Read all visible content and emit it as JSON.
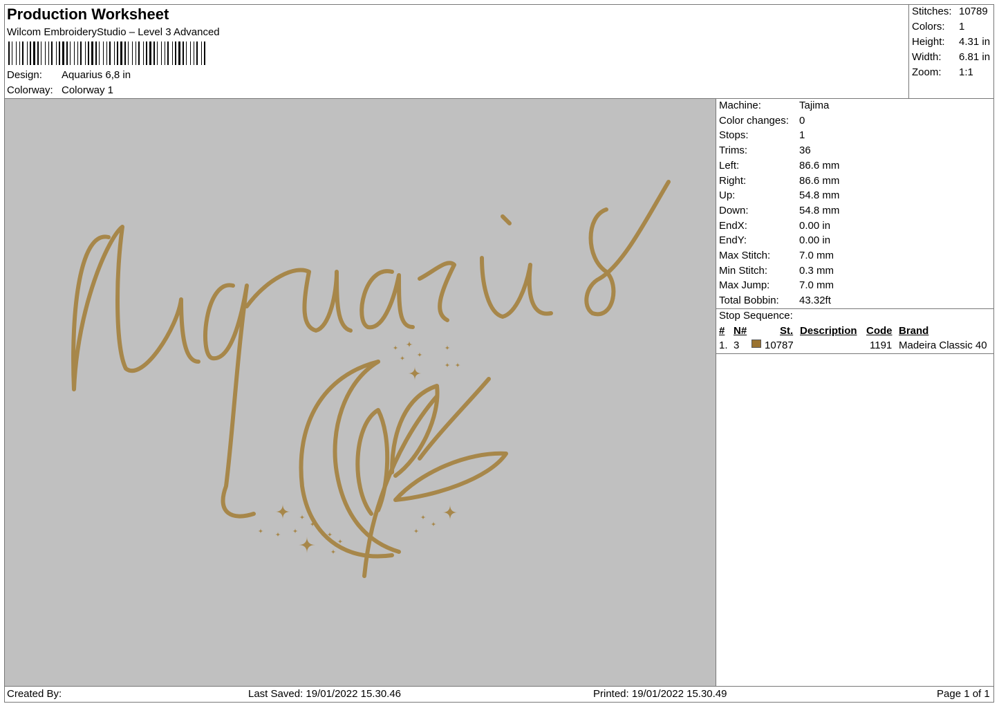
{
  "header": {
    "title": "Production Worksheet",
    "software": "Wilcom EmbroideryStudio – Level 3 Advanced",
    "design_label": "Design:",
    "design_value": "Aquarius 6,8 in",
    "colorway_label": "Colorway:",
    "colorway_value": "Colorway 1"
  },
  "summary": [
    {
      "label": "Stitches:",
      "value": "10789"
    },
    {
      "label": "Colors:",
      "value": "1"
    },
    {
      "label": "Height:",
      "value": "4.31 in"
    },
    {
      "label": "Width:",
      "value": "6.81 in"
    },
    {
      "label": "Zoom:",
      "value": "1:1"
    }
  ],
  "details": [
    {
      "label": "Machine:",
      "value": "Tajima"
    },
    {
      "label": "Color changes:",
      "value": "0"
    },
    {
      "label": "Stops:",
      "value": "1"
    },
    {
      "label": "Trims:",
      "value": "36"
    },
    {
      "label": "Left:",
      "value": "86.6 mm"
    },
    {
      "label": "Right:",
      "value": "86.6 mm"
    },
    {
      "label": "Up:",
      "value": "54.8 mm"
    },
    {
      "label": "Down:",
      "value": "54.8 mm"
    },
    {
      "label": "EndX:",
      "value": "0.00 in"
    },
    {
      "label": "EndY:",
      "value": "0.00 in"
    },
    {
      "label": "Max Stitch:",
      "value": "7.0 mm"
    },
    {
      "label": "Min Stitch:",
      "value": "0.3 mm"
    },
    {
      "label": "Max Jump:",
      "value": "7.0 mm"
    },
    {
      "label": "Total Bobbin:",
      "value": "43.32ft"
    }
  ],
  "stop_sequence": {
    "title": "Stop Sequence:",
    "headers": {
      "num": "#",
      "n": "N#",
      "st": "St.",
      "description": "Description",
      "code": "Code",
      "brand": "Brand"
    },
    "rows": [
      {
        "num": "1.",
        "n": "3",
        "st": "10787",
        "description": "",
        "code": "1191",
        "brand": "Madeira Classic 40",
        "color": "#9a7331"
      }
    ]
  },
  "design_preview": {
    "text": "Aquarius",
    "thread_color": "#a7874a"
  },
  "footer": {
    "created_by": "Created By:",
    "last_saved": "Last Saved: 19/01/2022 15.30.46",
    "printed": "Printed: 19/01/2022 15.30.49",
    "page": "Page 1 of 1"
  }
}
